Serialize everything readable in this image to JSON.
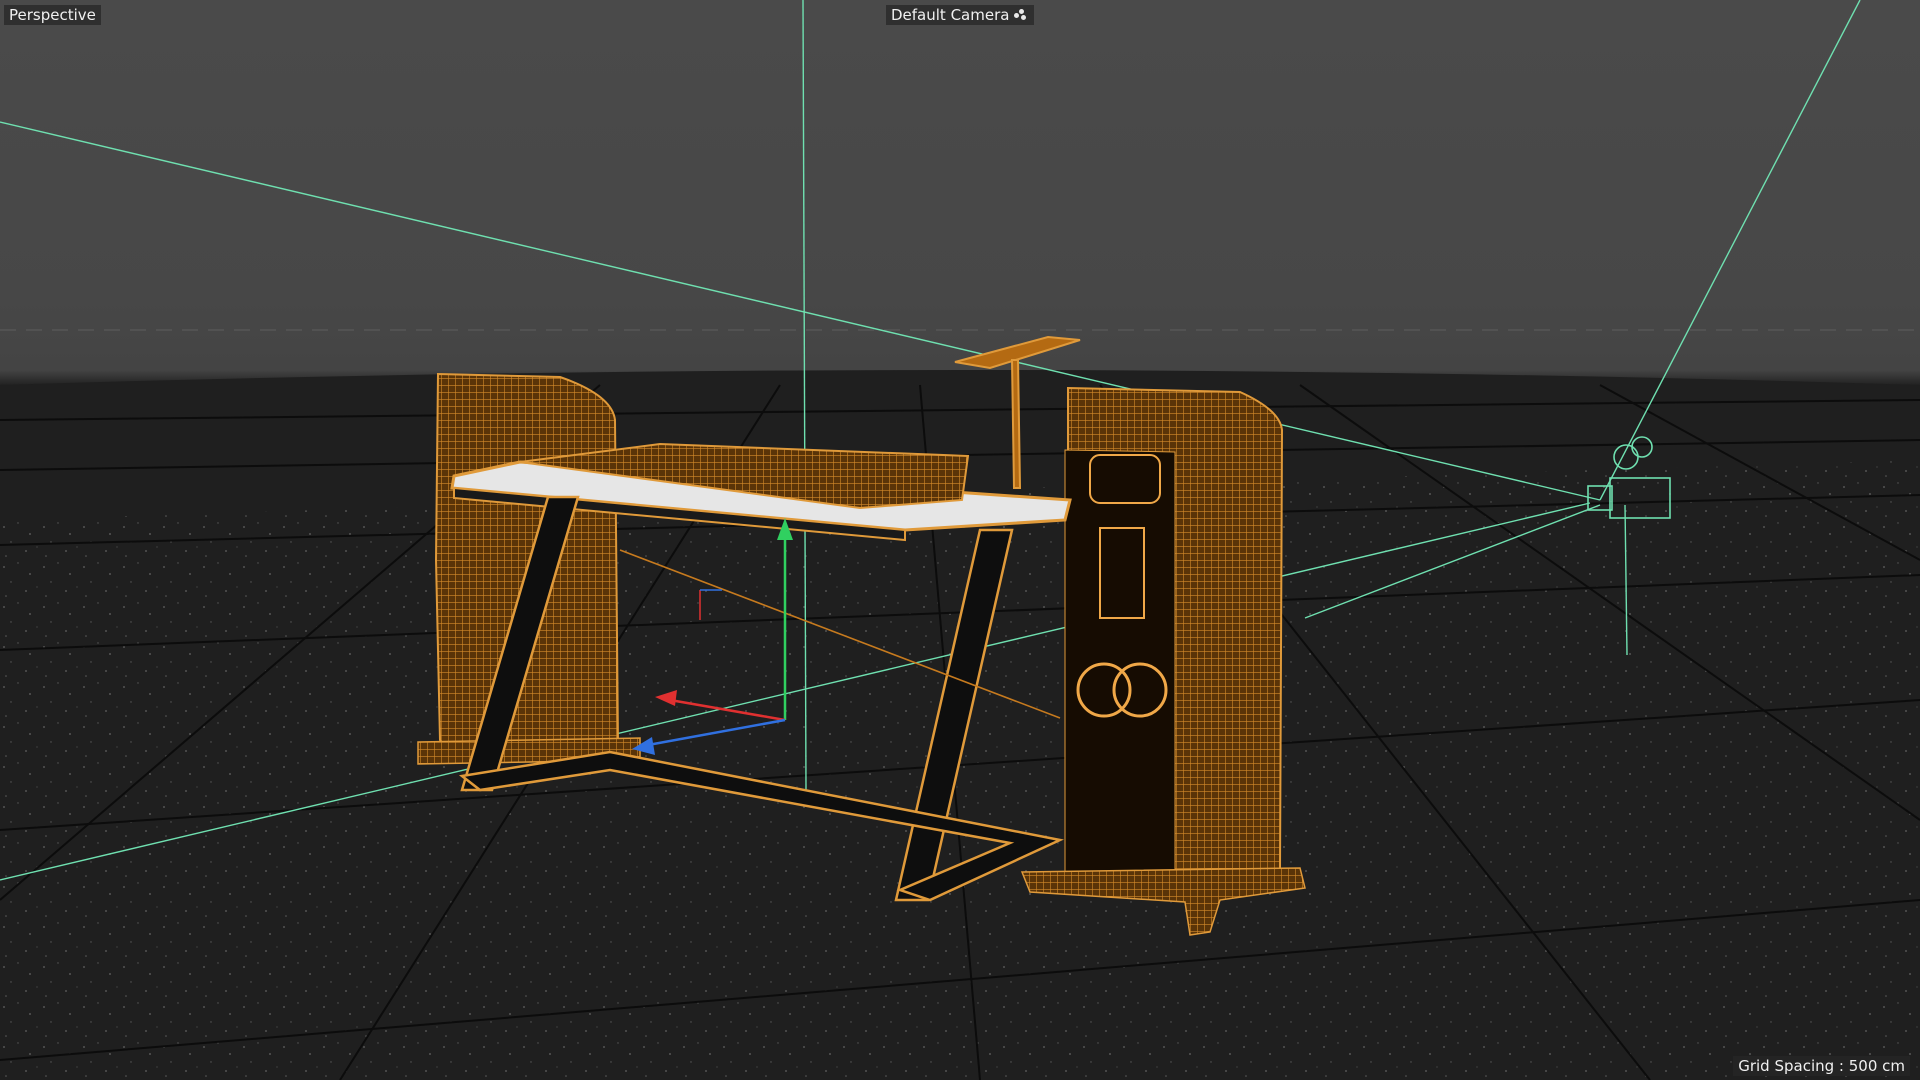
{
  "viewport": {
    "view_name": "Perspective",
    "camera_name": "Default Camera",
    "camera_icon": "camera-link-icon",
    "grid_spacing": "Grid Spacing : 500 cm"
  },
  "colors": {
    "background_top": "#4a4a4a",
    "floor": "#1c1c1c",
    "wireframe": "#c67a1e",
    "axis_guides": "#6fe0b0",
    "gizmo_x": "#e03030",
    "gizmo_y": "#30d060",
    "gizmo_z": "#3070e0"
  },
  "scene_objects": [
    {
      "name": "speaker-left",
      "type": "wireframe mesh"
    },
    {
      "name": "speaker-right",
      "type": "wireframe mesh"
    },
    {
      "name": "desk",
      "type": "wireframe mesh"
    },
    {
      "name": "monitor-arm",
      "type": "wireframe mesh"
    },
    {
      "name": "scene-camera",
      "type": "camera"
    },
    {
      "name": "transform-gizmo",
      "type": "gizmo"
    }
  ]
}
